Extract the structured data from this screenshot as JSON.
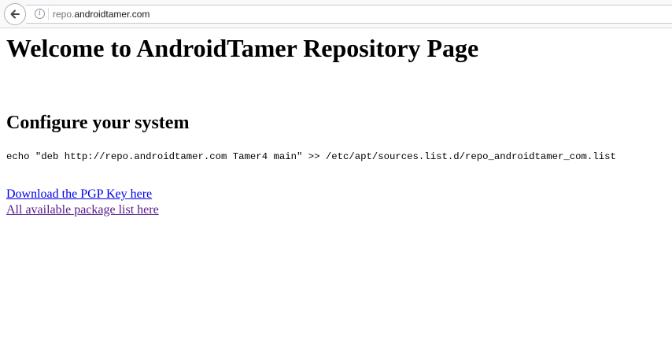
{
  "browser": {
    "url_scheme_part": "repo.",
    "url_host_part": "androidtamer.com",
    "info_glyph": "i",
    "back_icon": "back-arrow-icon"
  },
  "page": {
    "title": "Welcome to AndroidTamer Repository Page",
    "section_title": "Configure your system",
    "command": "echo \"deb http://repo.androidtamer.com Tamer4 main\" >> /etc/apt/sources.list.d/repo_androidtamer_com.list",
    "links": [
      {
        "label": "Download the PGP Key here",
        "visited": false
      },
      {
        "label": "All available package list here",
        "visited": true
      }
    ]
  },
  "colors": {
    "link": "#0000ee",
    "visited_link": "#551a8b"
  }
}
